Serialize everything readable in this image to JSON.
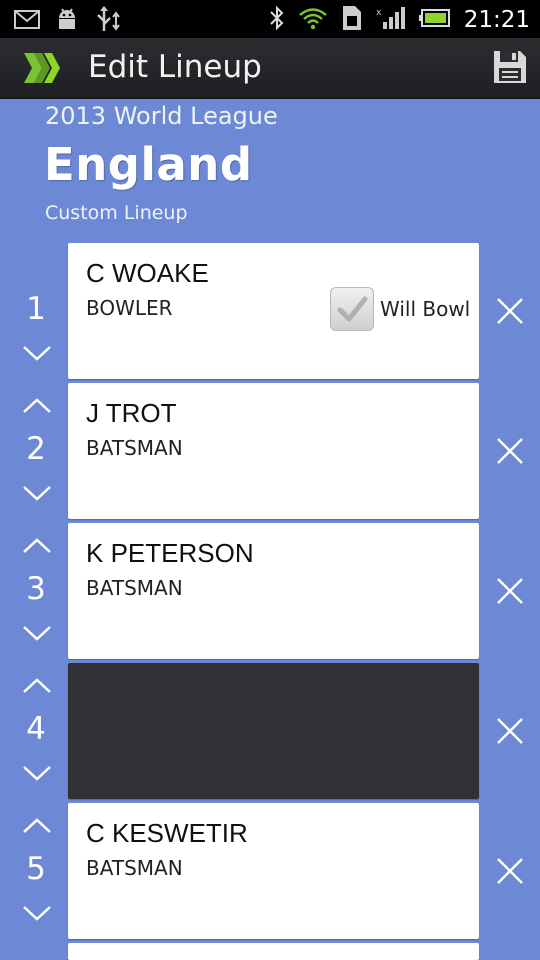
{
  "status_bar": {
    "time": "21:21"
  },
  "action_bar": {
    "title": "Edit Lineup"
  },
  "header": {
    "league": "2013 World League",
    "team": "England",
    "lineup_type": "Custom Lineup"
  },
  "rows": [
    {
      "number": "1",
      "name": "C WOAKE",
      "role": "BOWLER",
      "will_bowl_label": "Will Bowl",
      "will_bowl": true
    },
    {
      "number": "2",
      "name": "J TROT",
      "role": "BATSMAN"
    },
    {
      "number": "3",
      "name": "K PETERSON",
      "role": "BATSMAN"
    },
    {
      "number": "4",
      "name": "",
      "role": ""
    },
    {
      "number": "5",
      "name": "C KESWETIR",
      "role": "BATSMAN"
    }
  ],
  "colors": {
    "background": "#6d89d5",
    "action_bar": "#2b2d30",
    "logo_green": "#7cc232"
  }
}
